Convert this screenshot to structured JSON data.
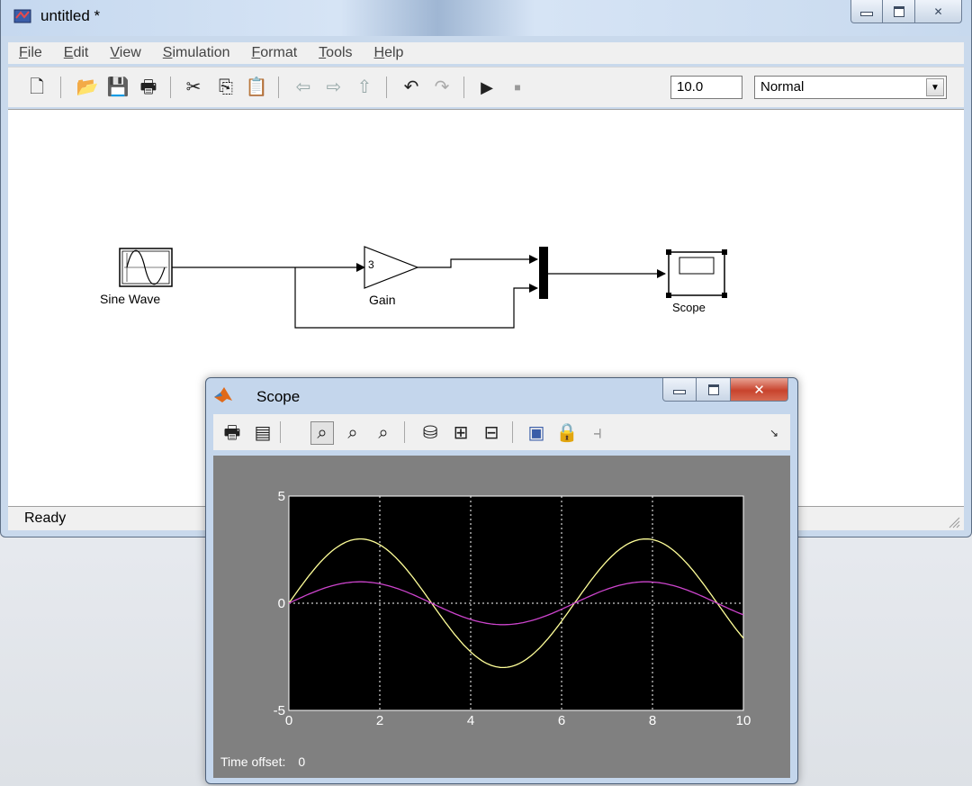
{
  "main_window": {
    "title": "untitled *",
    "menu": [
      "File",
      "Edit",
      "View",
      "Simulation",
      "Format",
      "Tools",
      "Help"
    ],
    "stop_time": "10.0",
    "sim_mode": "Normal",
    "status": "Ready",
    "blocks": {
      "sine_wave_label": "Sine Wave",
      "gain_label": "Gain",
      "gain_value": "3",
      "scope_label": "Scope"
    }
  },
  "scope_window": {
    "title": "Scope",
    "time_offset_label": "Time offset:",
    "time_offset_value": "0"
  },
  "chart_data": {
    "type": "line",
    "title": "",
    "xlabel": "",
    "ylabel": "",
    "xlim": [
      0,
      10
    ],
    "ylim": [
      -5,
      5
    ],
    "xticks": [
      0,
      2,
      4,
      6,
      8,
      10
    ],
    "yticks": [
      -5,
      0,
      5
    ],
    "grid": true,
    "background": "#000000",
    "series": [
      {
        "color": "#ffff99",
        "amplitude": 3,
        "function": "3*sin(t)"
      },
      {
        "color": "#cc44cc",
        "amplitude": 1,
        "function": "sin(t)"
      }
    ]
  }
}
